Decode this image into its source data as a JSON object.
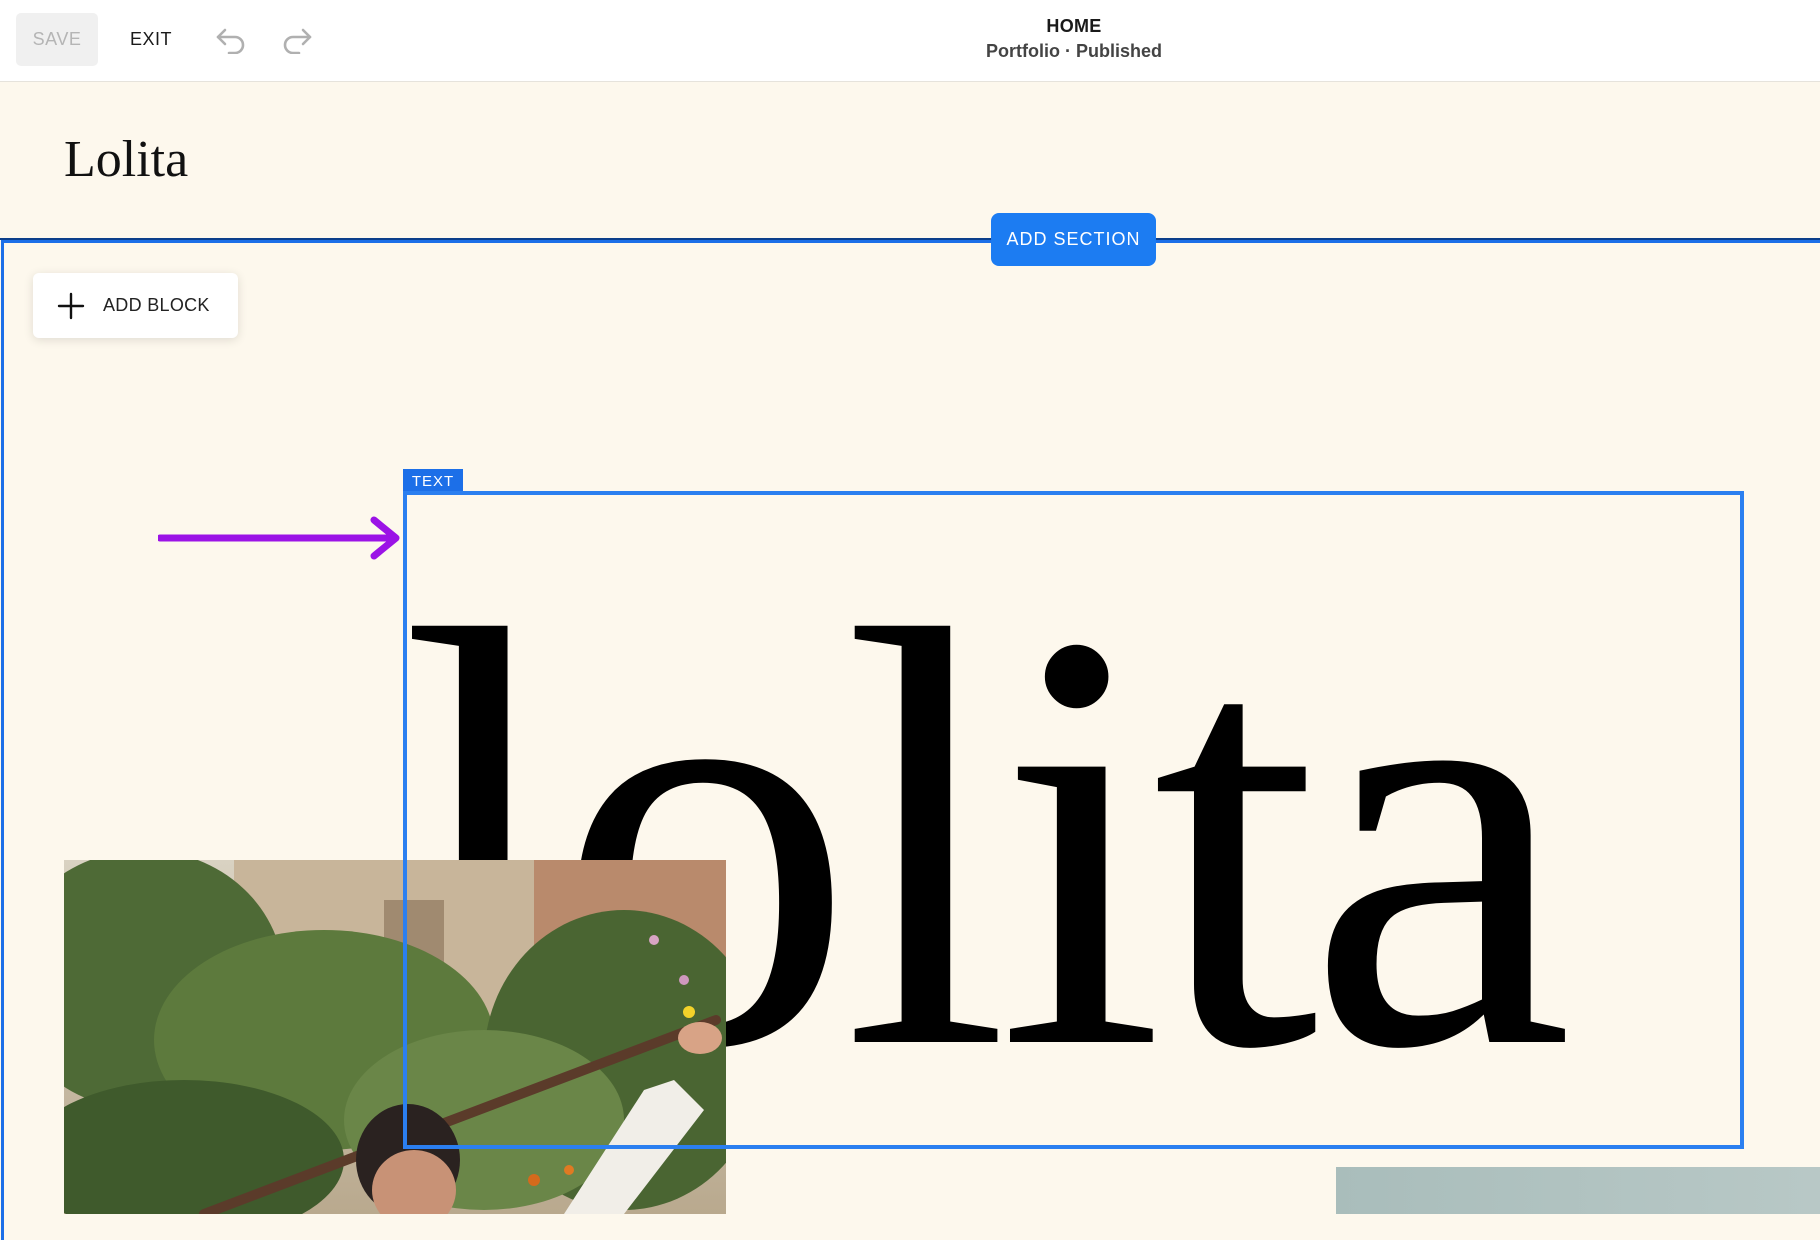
{
  "toolbar": {
    "save_label": "SAVE",
    "exit_label": "EXIT",
    "undo_icon": "undo-icon",
    "redo_icon": "redo-icon"
  },
  "page": {
    "title": "HOME",
    "subtitle": "Portfolio · Published"
  },
  "site": {
    "logo": "Lolita"
  },
  "editor": {
    "add_section_label": "ADD SECTION",
    "add_block_label": "ADD BLOCK",
    "block_type_tag": "TEXT",
    "accent_color": "#1c6fe8",
    "annotation_arrow_color": "#9b13e6"
  },
  "content": {
    "headline": "lolita"
  }
}
